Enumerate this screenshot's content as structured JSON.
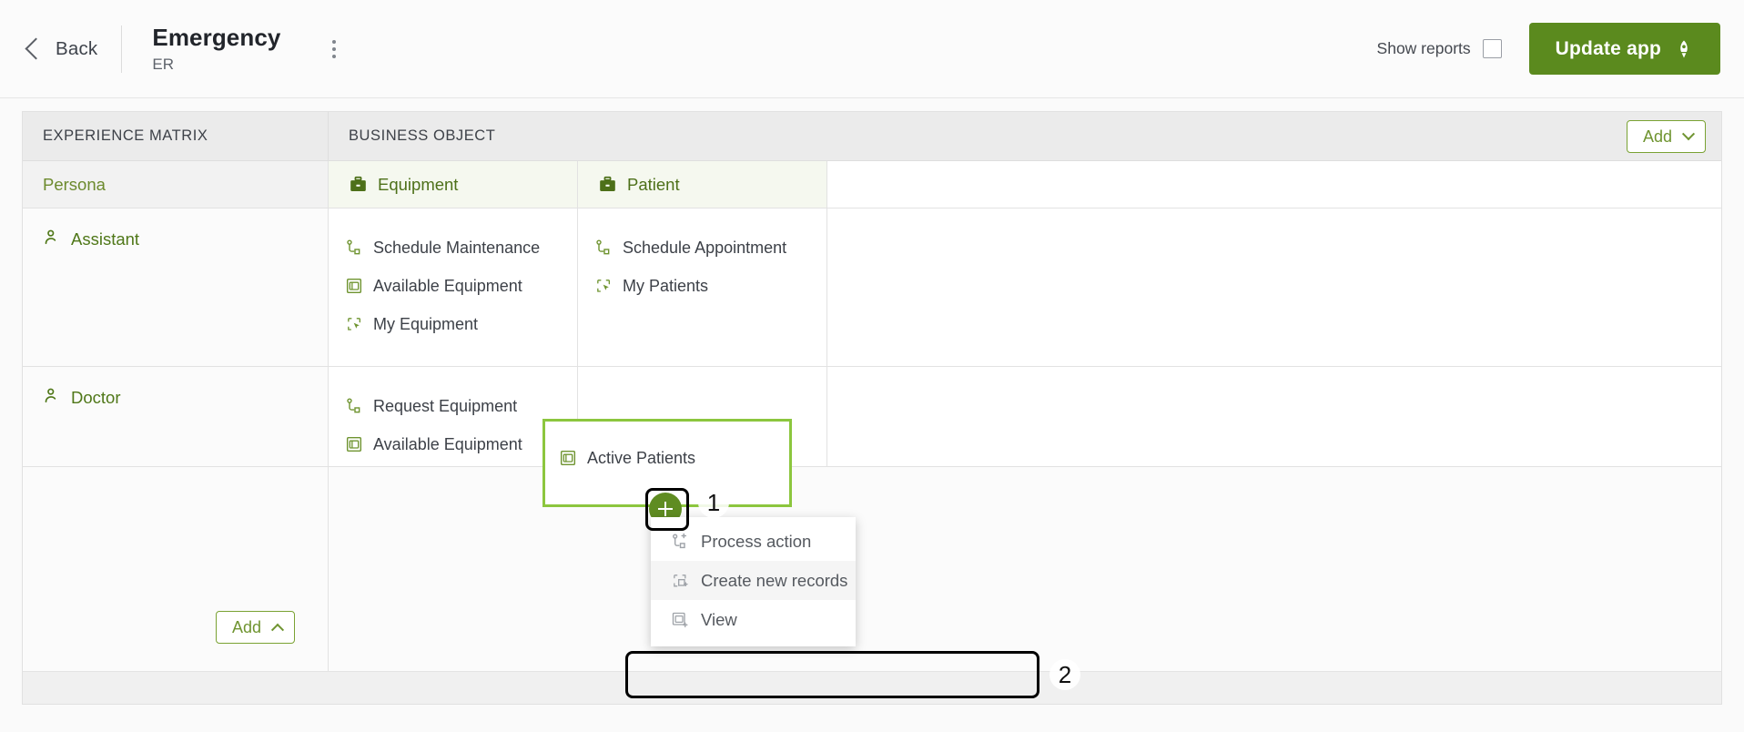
{
  "topbar": {
    "back_label": "Back",
    "app_title": "Emergency",
    "app_subtitle": "ER",
    "kebab_name": "more-options",
    "show_reports_label": "Show reports",
    "show_reports_checked": false,
    "update_button_label": "Update app",
    "update_button_icon": "rocket-icon",
    "update_button_color": "#5b8a1e"
  },
  "matrix": {
    "header": {
      "left": "EXPERIENCE MATRIX",
      "right": "BUSINESS OBJECT",
      "add_label": "Add",
      "add_icon": "chevron-down-icon"
    },
    "subheader": {
      "persona": "Persona",
      "objects": [
        {
          "label": "Equipment",
          "icon": "briefcase-icon"
        },
        {
          "label": "Patient",
          "icon": "briefcase-icon"
        }
      ]
    },
    "rows": [
      {
        "persona": "Assistant",
        "persona_icon": "person-icon",
        "cells": [
          {
            "items": [
              {
                "label": "Schedule Maintenance",
                "icon": "process-action-icon"
              },
              {
                "label": "Available Equipment",
                "icon": "view-icon"
              },
              {
                "label": "My Equipment",
                "icon": "create-records-icon"
              }
            ]
          },
          {
            "items": [
              {
                "label": "Schedule Appointment",
                "icon": "process-action-icon"
              },
              {
                "label": "My Patients",
                "icon": "create-records-icon"
              }
            ]
          }
        ]
      },
      {
        "persona": "Doctor",
        "persona_icon": "person-icon",
        "cells": [
          {
            "items": [
              {
                "label": "Request Equipment",
                "icon": "process-action-icon"
              },
              {
                "label": "Available Equipment",
                "icon": "view-icon"
              }
            ]
          },
          {
            "selected": true,
            "items": [
              {
                "label": "Active Patients",
                "icon": "view-icon"
              }
            ]
          }
        ]
      }
    ],
    "selected_cell": {
      "item_label": "Active Patients",
      "item_icon": "view-icon",
      "border_color": "#8cc63e"
    },
    "add_bottom_label": "Add",
    "add_bottom_icon": "chevron-up-icon"
  },
  "add_menu": {
    "trigger_icon": "plus-icon",
    "trigger_color": "#5f8c22",
    "items": [
      {
        "label": "Process action",
        "icon": "process-action-icon",
        "highlighted": false
      },
      {
        "label": "Create new records",
        "icon": "create-records-icon",
        "highlighted": true
      },
      {
        "label": "View",
        "icon": "view-icon",
        "highlighted": false
      }
    ]
  },
  "annotations": [
    {
      "number": "1",
      "target": "plus-button"
    },
    {
      "number": "2",
      "target": "create-new-records-menu-item"
    }
  ]
}
